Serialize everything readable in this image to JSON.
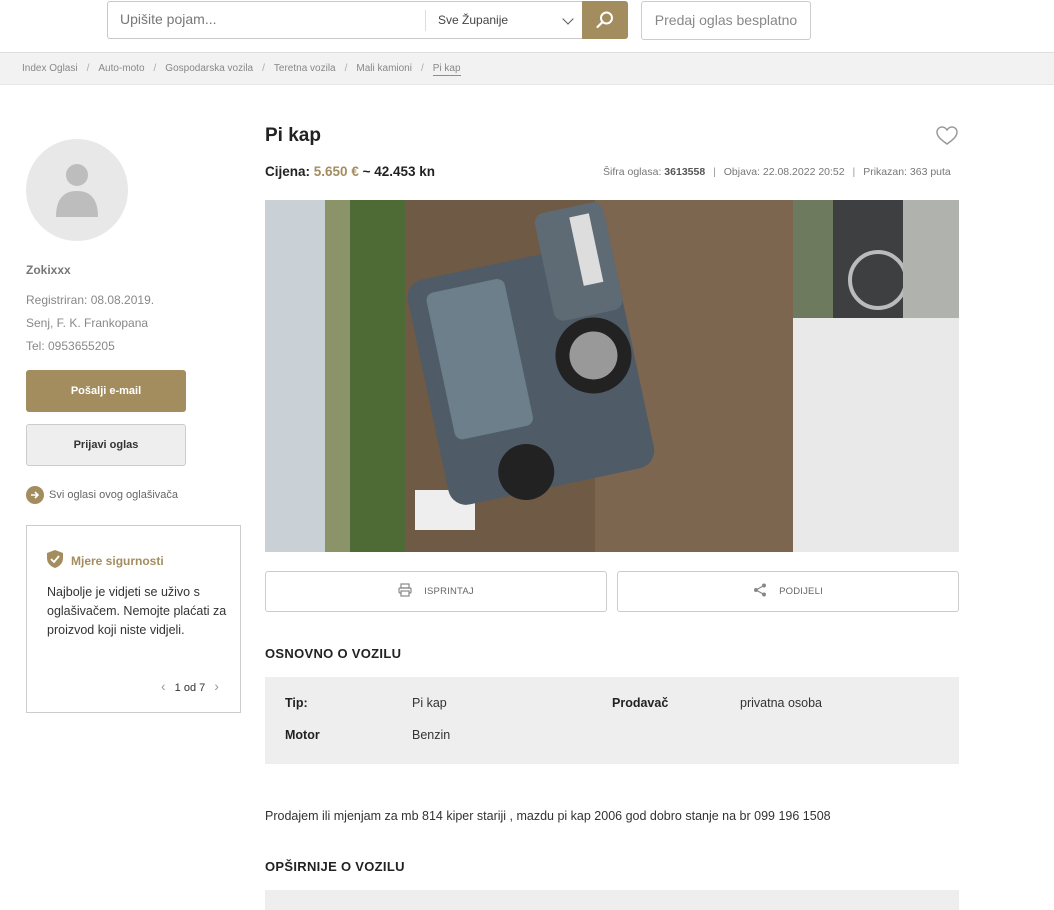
{
  "header": {
    "search_placeholder": "Upišite pojam...",
    "county_selected": "Sve Županije",
    "post_ad_label": "Predaj oglas besplatno"
  },
  "breadcrumb": {
    "items": [
      "Index Oglasi",
      "Auto-moto",
      "Gospodarska vozila",
      "Teretna vozila",
      "Mali kamioni"
    ],
    "current": "Pi kap",
    "separator": "/"
  },
  "seller": {
    "name": "Zokixxx",
    "registered": "Registriran: 08.08.2019.",
    "location": "Senj, F. K. Frankopana",
    "phone": "Tel: 0953655205",
    "email_button": "Pošalji e-mail",
    "report_button": "Prijavi oglas",
    "all_ads_link": "Svi oglasi ovog oglašivača"
  },
  "safety": {
    "title": "Mjere sigurnosti",
    "text": "Najbolje je vidjeti se uživo s oglašivačem. Nemojte plaćati za proizvod koji niste vidjeli.",
    "pager": "1 od 7",
    "prev": "‹",
    "next": "›"
  },
  "ad": {
    "title": "Pi kap",
    "price_label": "Cijena:",
    "price_eur": "5.650 €",
    "price_kn": "~ 42.453 kn",
    "meta": {
      "code_label": "Šifra oglasa:",
      "code": "3613558",
      "published": "Objava: 22.08.2022 20:52",
      "views": "Prikazan: 363 puta",
      "sep": "|"
    },
    "print_label": "ISPRINTAJ",
    "share_label": "PODIJELI",
    "basic_title": "OSNOVNO O VOZILU",
    "specs": [
      {
        "label": "Tip:",
        "value": "Pi kap"
      },
      {
        "label": "Prodavač",
        "value": "privatna osoba"
      },
      {
        "label": "Motor",
        "value": "Benzin"
      }
    ],
    "description": "Prodajem ili mjenjam za mb 814 kiper stariji , mazdu pi kap 2006 god dobro stanje na br 099 196 1508",
    "more_title": "OPŠIRNIJE O VOZILU"
  },
  "colors": {
    "accent": "#a38d5f",
    "panel": "#eeeeee"
  },
  "icons": [
    "search-icon",
    "chevron-down-icon",
    "user-avatar-icon",
    "arrow-right-icon",
    "shield-check-icon",
    "heart-icon",
    "printer-icon",
    "share-icon"
  ]
}
